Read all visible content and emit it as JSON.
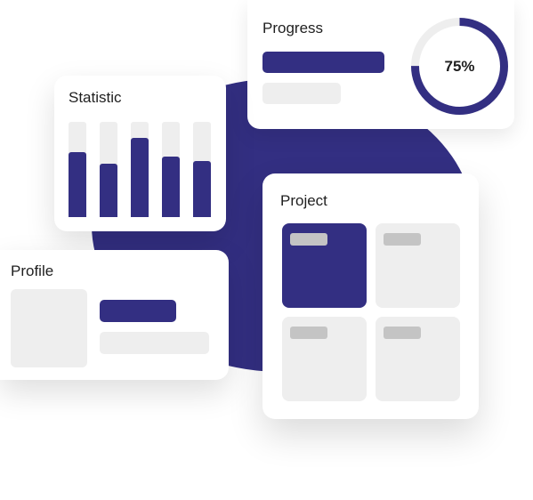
{
  "colors": {
    "accent": "#332f82",
    "placeholder": "#eeeeee",
    "tag": "#c4c4c4",
    "card": "#ffffff"
  },
  "progress": {
    "title": "Progress",
    "percent_label": "75%",
    "value": 0.75
  },
  "statistic": {
    "title": "Statistic",
    "bar_levels": [
      0.68,
      0.56,
      0.83,
      0.64,
      0.59
    ]
  },
  "profile": {
    "title": "Profile"
  },
  "project": {
    "title": "Project",
    "tiles": [
      {
        "active": true
      },
      {
        "active": false
      },
      {
        "active": false
      },
      {
        "active": false
      }
    ]
  }
}
